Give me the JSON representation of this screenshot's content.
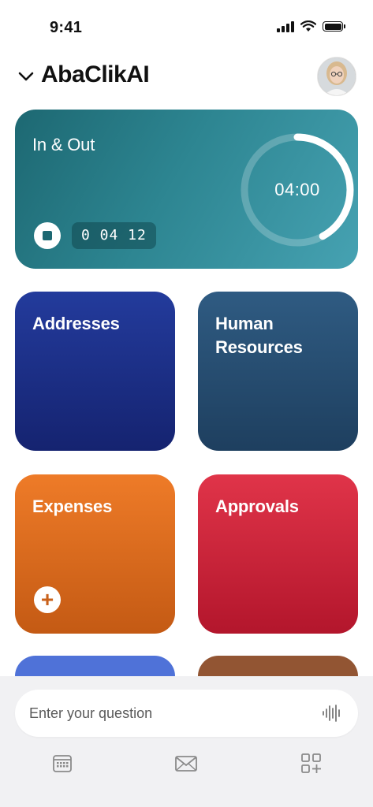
{
  "status_bar": {
    "time": "9:41"
  },
  "header": {
    "title": "AbaClikAI"
  },
  "in_out": {
    "label": "In & Out",
    "countdown": "04:00",
    "elapsed": "0 04 12",
    "ring_progress": 0.42
  },
  "tiles": {
    "addresses": "Addresses",
    "human_resources": "Human Resources",
    "expenses": "Expenses",
    "approvals": "Approvals",
    "expenses_add": "+"
  },
  "ask": {
    "placeholder": "Enter your question"
  },
  "tab_bar": {
    "items": [
      "calendar-icon",
      "mail-icon",
      "apps-add-icon"
    ]
  }
}
